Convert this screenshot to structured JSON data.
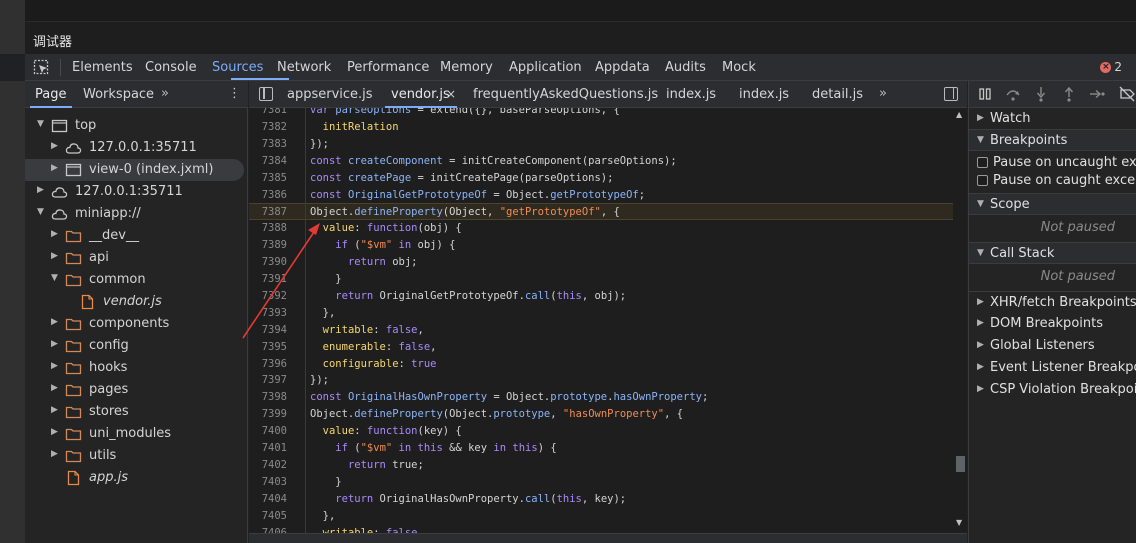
{
  "window": {
    "title": "调试器"
  },
  "toolbar": {
    "tabs": [
      "Elements",
      "Console",
      "Sources",
      "Network",
      "Performance",
      "Memory",
      "Application",
      "Appdata",
      "Audits",
      "Mock"
    ],
    "active_tab": "Sources",
    "error_count": "2"
  },
  "navigator": {
    "tabs": [
      "Page",
      "Workspace"
    ],
    "active_tab": "Page",
    "more": "»",
    "menu": "⋮",
    "tree": [
      {
        "label": "top",
        "type": "frame",
        "expanded": true
      },
      {
        "label": "127.0.0.1:35711",
        "type": "cloud",
        "expanded": false
      },
      {
        "label": "view-0 (index.jxml)",
        "type": "frame",
        "expanded": false,
        "selected": true
      },
      {
        "label": "127.0.0.1:35711",
        "type": "cloud",
        "expanded": false
      },
      {
        "label": "miniapp://",
        "type": "cloud",
        "expanded": true
      },
      {
        "label": "__dev__",
        "type": "folder",
        "expanded": false
      },
      {
        "label": "api",
        "type": "folder",
        "expanded": false
      },
      {
        "label": "common",
        "type": "folder",
        "expanded": true
      },
      {
        "label": "vendor.js",
        "type": "file",
        "italic": true
      },
      {
        "label": "components",
        "type": "folder",
        "expanded": false
      },
      {
        "label": "config",
        "type": "folder",
        "expanded": false
      },
      {
        "label": "hooks",
        "type": "folder",
        "expanded": false
      },
      {
        "label": "pages",
        "type": "folder",
        "expanded": false
      },
      {
        "label": "stores",
        "type": "folder",
        "expanded": false
      },
      {
        "label": "uni_modules",
        "type": "folder",
        "expanded": false
      },
      {
        "label": "utils",
        "type": "folder",
        "expanded": false
      },
      {
        "label": "app.js",
        "type": "file",
        "italic": true
      }
    ]
  },
  "editor": {
    "tabs": [
      "appservice.js",
      "vendor.js",
      "frequentlyAskedQuestions.js",
      "index.js",
      "index.js",
      "detail.js"
    ],
    "active_tab": "vendor.js",
    "close": "×",
    "more": "»",
    "highlight_line": "7387",
    "lines": [
      {
        "n": "7381",
        "html": "<span class=\"k\">var</span> <span class=\"v\">parseOptions</span> = extend({}, baseParseOptions, {"
      },
      {
        "n": "7382",
        "html": "  <span class=\"p\">initRelation</span>"
      },
      {
        "n": "7383",
        "html": "});"
      },
      {
        "n": "7384",
        "html": "<span class=\"k\">const</span> <span class=\"v\">createComponent</span> = initCreateComponent(parseOptions);"
      },
      {
        "n": "7385",
        "html": "<span class=\"k\">const</span> <span class=\"v\">createPage</span> = initCreatePage(parseOptions);"
      },
      {
        "n": "7386",
        "html": "<span class=\"k\">const</span> <span class=\"v\">OriginalGetPrototypeOf</span> = Object.<span class=\"v\">getPrototypeOf</span>;"
      },
      {
        "n": "7387",
        "html": "Object.<span class=\"v\">defineProperty</span>(Object, <span class=\"s\">\"getPrototypeOf\"</span>, {"
      },
      {
        "n": "7388",
        "html": "  <span class=\"p\">value</span>: <span class=\"k\">function</span>(obj) {"
      },
      {
        "n": "7389",
        "html": "    <span class=\"k\">if</span> (<span class=\"s\">\"$vm\"</span> <span class=\"k\">in</span> obj) {"
      },
      {
        "n": "7390",
        "html": "      <span class=\"k\">return</span> obj;"
      },
      {
        "n": "7391",
        "html": "    }"
      },
      {
        "n": "7392",
        "html": "    <span class=\"k\">return</span> OriginalGetPrototypeOf.<span class=\"v\">call</span>(<span class=\"k\">this</span>, obj);"
      },
      {
        "n": "7393",
        "html": "  },"
      },
      {
        "n": "7394",
        "html": "  <span class=\"p\">writable</span>: <span class=\"k\">false</span>,"
      },
      {
        "n": "7395",
        "html": "  <span class=\"p\">enumerable</span>: <span class=\"k\">false</span>,"
      },
      {
        "n": "7396",
        "html": "  <span class=\"p\">configurable</span>: <span class=\"k\">true</span>"
      },
      {
        "n": "7397",
        "html": "});"
      },
      {
        "n": "7398",
        "html": "<span class=\"k\">const</span> <span class=\"v\">OriginalHasOwnProperty</span> = Object.<span class=\"v\">prototype</span>.<span class=\"v\">hasOwnProperty</span>;"
      },
      {
        "n": "7399",
        "html": "Object.<span class=\"v\">defineProperty</span>(Object.<span class=\"v\">prototype</span>, <span class=\"s\">\"hasOwnProperty\"</span>, {"
      },
      {
        "n": "7400",
        "html": "  <span class=\"p\">value</span>: <span class=\"k\">function</span>(key) {"
      },
      {
        "n": "7401",
        "html": "    <span class=\"k\">if</span> (<span class=\"s\">\"$vm\"</span> <span class=\"k\">in</span> <span class=\"k\">this</span> &amp;&amp; key <span class=\"k\">in</span> <span class=\"k\">this</span>) {"
      },
      {
        "n": "7402",
        "html": "      <span class=\"k\">return</span> true;"
      },
      {
        "n": "7403",
        "html": "    }"
      },
      {
        "n": "7404",
        "html": "    <span class=\"k\">return</span> OriginalHasOwnProperty.<span class=\"v\">call</span>(<span class=\"k\">this</span>, key);"
      },
      {
        "n": "7405",
        "html": "  },"
      },
      {
        "n": "7406",
        "html": "  <span class=\"p\">writable</span>: <span class=\"k\">false</span>,"
      }
    ]
  },
  "debugger": {
    "panes": {
      "watch": "Watch",
      "breakpoints": "Breakpoints",
      "pause_uncaught": "Pause on uncaught exceptions",
      "pause_caught": "Pause on caught exceptions",
      "scope": "Scope",
      "scope_status": "Not paused",
      "call_stack": "Call Stack",
      "call_stack_status": "Not paused",
      "xhr": "XHR/fetch Breakpoints",
      "dom": "DOM Breakpoints",
      "global": "Global Listeners",
      "event": "Event Listener Breakpoints",
      "csp": "CSP Violation Breakpoints"
    }
  },
  "colors": {
    "accent": "#7cacf8",
    "annotation_arrow": "#e53935",
    "error": "#e46962"
  }
}
